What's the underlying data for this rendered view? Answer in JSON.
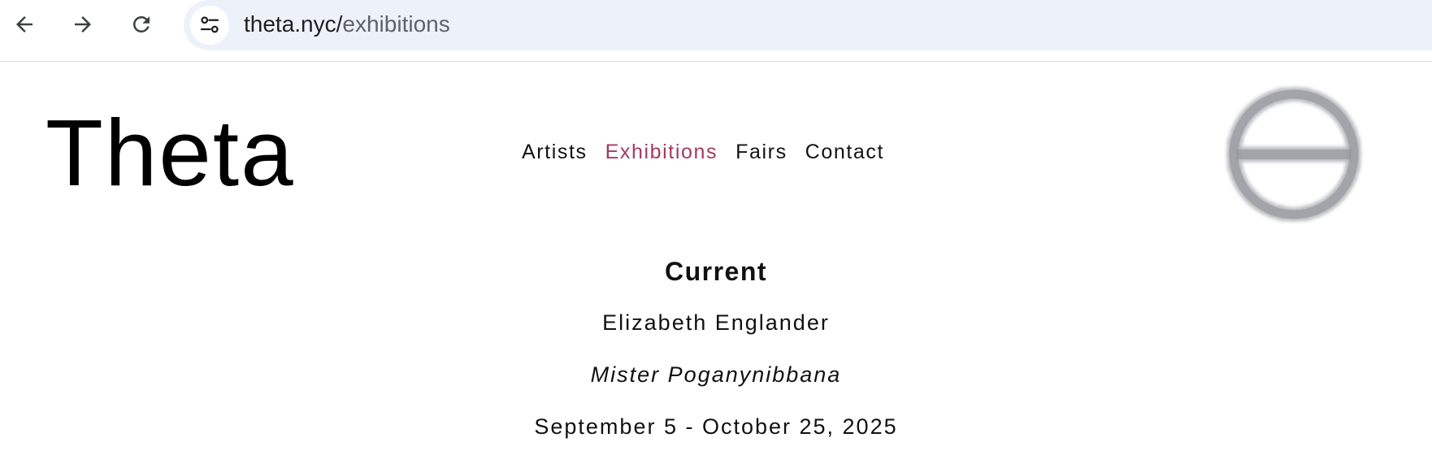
{
  "browser": {
    "url_host": "theta.nyc/",
    "url_path": "exhibitions",
    "icons": {
      "back": "arrow-left-icon",
      "forward": "arrow-right-icon",
      "reload": "reload-icon",
      "site_info": "tune-icon"
    }
  },
  "header": {
    "logo": "Theta",
    "nav": [
      {
        "label": "Artists",
        "active": false
      },
      {
        "label": "Exhibitions",
        "active": true
      },
      {
        "label": "Fairs",
        "active": false
      },
      {
        "label": "Contact",
        "active": false
      }
    ],
    "emblem_icon": "theta-emblem-icon"
  },
  "exhibitions": {
    "section_title": "Current",
    "artist": "Elizabeth Englander",
    "title": "Mister Poganynibbana",
    "dates": "September 5 - October 25, 2025"
  },
  "colors": {
    "accent": "#a43a5e",
    "omnibox": "#edf2fa",
    "emblem": "#8e9097",
    "text": "#111111"
  }
}
